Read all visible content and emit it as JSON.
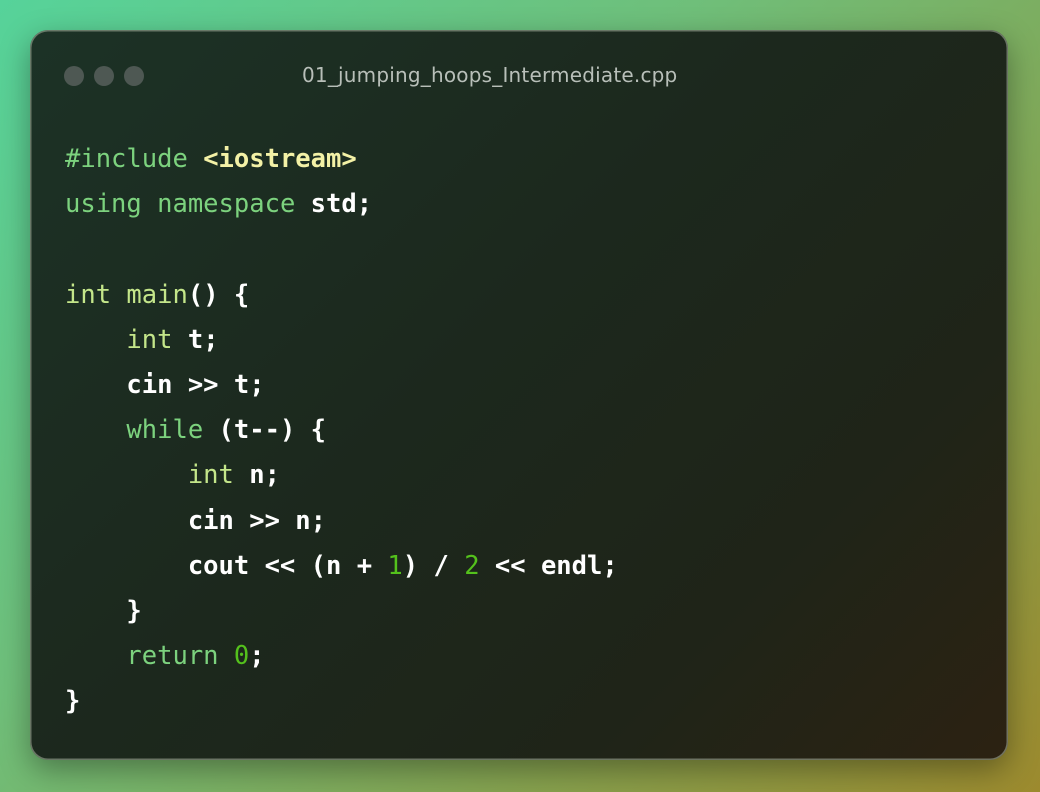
{
  "window": {
    "title": "01_jumping_hoops_Intermediate.cpp",
    "controls": [
      "close",
      "minimize",
      "zoom"
    ]
  },
  "colors": {
    "background_start": "#56d39a",
    "background_end": "#9c8a2e",
    "window_bg": "#1c281d",
    "keyword": "#7cd27e",
    "type": "#c4e68a",
    "string": "#f3f1a6",
    "number": "#54c11c",
    "plain": "#ffffff"
  },
  "code": {
    "language": "cpp",
    "lines": [
      [
        {
          "t": "pp",
          "v": "#include"
        },
        {
          "t": "plain",
          "v": " "
        },
        {
          "t": "str",
          "v": "<iostream>"
        }
      ],
      [
        {
          "t": "kw",
          "v": "using"
        },
        {
          "t": "plain",
          "v": " "
        },
        {
          "t": "kw",
          "v": "namespace"
        },
        {
          "t": "plain",
          "v": " std;"
        }
      ],
      [],
      [
        {
          "t": "type",
          "v": "int"
        },
        {
          "t": "plain",
          "v": " "
        },
        {
          "t": "fn",
          "v": "main"
        },
        {
          "t": "plain",
          "v": "() {"
        }
      ],
      [
        {
          "t": "plain",
          "v": "    "
        },
        {
          "t": "type",
          "v": "int"
        },
        {
          "t": "plain",
          "v": " t;"
        }
      ],
      [
        {
          "t": "plain",
          "v": "    cin >> t;"
        }
      ],
      [
        {
          "t": "plain",
          "v": "    "
        },
        {
          "t": "kw",
          "v": "while"
        },
        {
          "t": "plain",
          "v": " (t--) {"
        }
      ],
      [
        {
          "t": "plain",
          "v": "        "
        },
        {
          "t": "type",
          "v": "int"
        },
        {
          "t": "plain",
          "v": " n;"
        }
      ],
      [
        {
          "t": "plain",
          "v": "        cin >> n;"
        }
      ],
      [
        {
          "t": "plain",
          "v": "        cout << (n + "
        },
        {
          "t": "num",
          "v": "1"
        },
        {
          "t": "plain",
          "v": ") / "
        },
        {
          "t": "num",
          "v": "2"
        },
        {
          "t": "plain",
          "v": " << endl;"
        }
      ],
      [
        {
          "t": "plain",
          "v": "    }"
        }
      ],
      [
        {
          "t": "plain",
          "v": "    "
        },
        {
          "t": "kw",
          "v": "return"
        },
        {
          "t": "plain",
          "v": " "
        },
        {
          "t": "num",
          "v": "0"
        },
        {
          "t": "plain",
          "v": ";"
        }
      ],
      [
        {
          "t": "plain",
          "v": "}"
        }
      ]
    ]
  }
}
